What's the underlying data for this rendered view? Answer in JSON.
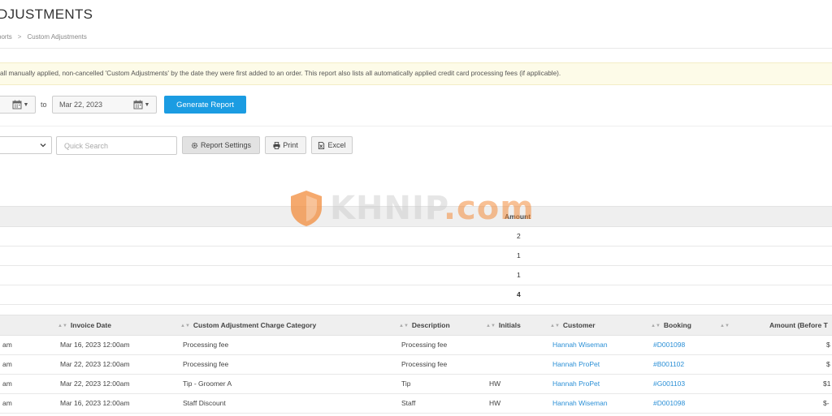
{
  "header": {
    "title": "DJUSTMENTS",
    "breadcrumb": {
      "parent": "ports",
      "separator": ">",
      "current": "Custom Adjustments"
    }
  },
  "banner": {
    "text": "all manually applied, non-cancelled 'Custom Adjustments' by the date they were first added to an order. This report also lists all automatically applied credit card processing fees (if applicable)."
  },
  "filters": {
    "to_label": "to",
    "end_date": "Mar 22, 2023",
    "generate_label": "Generate Report",
    "search_placeholder": "Quick Search",
    "settings_label": "Report Settings",
    "print_label": "Print",
    "excel_label": "Excel"
  },
  "summary": {
    "header_amount": "Amount",
    "rows": [
      "2",
      "1",
      "1"
    ],
    "total": "4"
  },
  "watermark": {
    "text_a": "KHNIP",
    "text_b": ".com"
  },
  "details": {
    "columns": {
      "time": "",
      "invoice_date": "Invoice Date",
      "category": "Custom Adjustment Charge Category",
      "description": "Description",
      "initials": "Initials",
      "customer": "Customer",
      "booking": "Booking",
      "amount": "Amount (Before T"
    },
    "rows": [
      {
        "time": "am",
        "invoice_date": "Mar 16, 2023 12:00am",
        "category": "Processing fee",
        "description": "Processing fee",
        "initials": "",
        "customer": "Hannah Wiseman",
        "booking": "#D001098",
        "amount": "$"
      },
      {
        "time": "am",
        "invoice_date": "Mar 22, 2023 12:00am",
        "category": "Processing fee",
        "description": "Processing fee",
        "initials": "",
        "customer": "Hannah ProPet",
        "booking": "#B001102",
        "amount": "$"
      },
      {
        "time": "am",
        "invoice_date": "Mar 22, 2023 12:00am",
        "category": "Tip - Groomer A",
        "description": "Tip",
        "initials": "HW",
        "customer": "Hannah ProPet",
        "booking": "#G001103",
        "amount": "$1"
      },
      {
        "time": "am",
        "invoice_date": "Mar 16, 2023 12:00am",
        "category": "Staff Discount",
        "description": "Staff",
        "initials": "HW",
        "customer": "Hannah Wiseman",
        "booking": "#D001098",
        "amount": "$-"
      }
    ]
  },
  "colors": {
    "accent": "#1b9ce2",
    "link": "#2a8fd6",
    "banner_bg": "#fdfbe8",
    "watermark": "#f28c3c"
  },
  "icons": [
    "calendar-icon",
    "chevron-down-icon",
    "gear-icon",
    "print-icon",
    "excel-icon",
    "sort-icon",
    "shield-icon"
  ]
}
